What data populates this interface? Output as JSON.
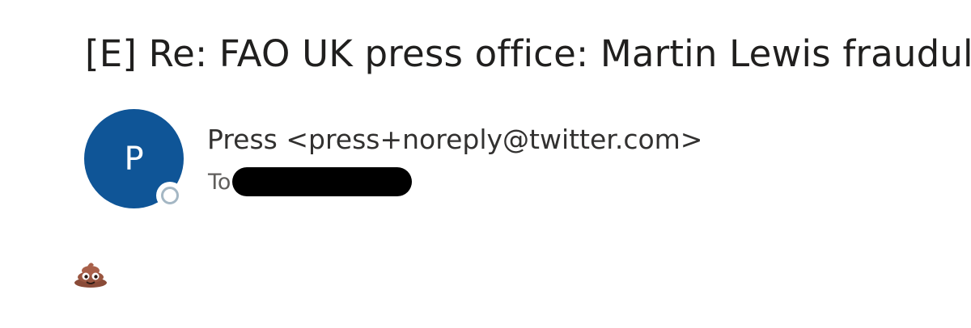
{
  "email": {
    "subject": "[E] Re: FAO UK press office: Martin Lewis fraudulent",
    "avatar_initial": "P",
    "sender": "Press <press+noreply@twitter.com>",
    "to_label": "To",
    "recipient_redacted": true,
    "body_emoji": "pile-of-poo-icon"
  },
  "colors": {
    "avatar_bg": "#0f5597",
    "presence_ring": "#a4b7c4",
    "text_primary": "#201f1e",
    "text_secondary": "#605e5c"
  }
}
